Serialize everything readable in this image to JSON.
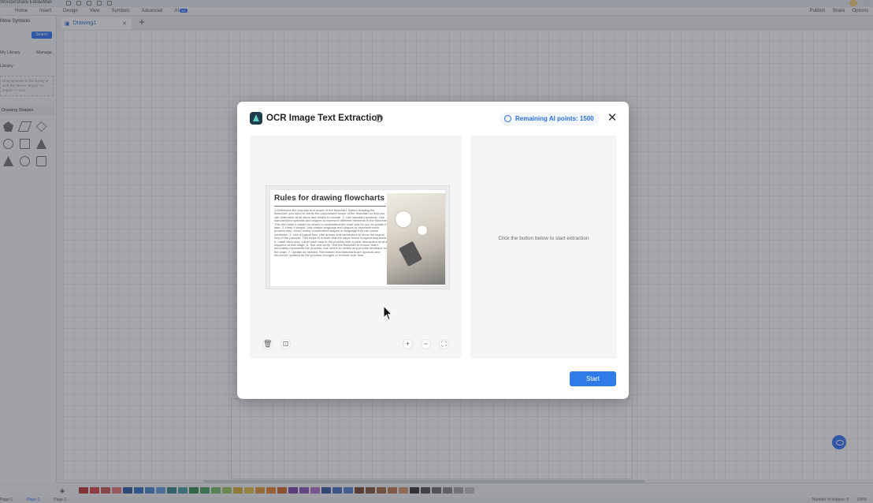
{
  "app": {
    "title": "Wondershare EdrawMax",
    "menu": [
      {
        "label": "Home"
      },
      {
        "label": "Insert"
      },
      {
        "label": "Design"
      },
      {
        "label": "View"
      },
      {
        "label": "Symbols"
      },
      {
        "label": "Advanced"
      },
      {
        "label": "AI",
        "badge": "hot"
      }
    ],
    "actions": {
      "publish": "Publish",
      "share": "Share",
      "options": "Options"
    },
    "doc_tab": "Drawing1"
  },
  "left_panel": {
    "title": "More Symbols",
    "search": "Search",
    "my_library": "My Library",
    "manage": "Manage",
    "library": "Library",
    "library_hint": "Drag symbols to the library or click the above \"Import\" to import \"+\" icon",
    "section": "Drawing Shapes"
  },
  "palette_colors": [
    "#c0393b",
    "#d24b4b",
    "#c85a5a",
    "#e07b7b",
    "#3a5fa6",
    "#3f74c4",
    "#4d8ad6",
    "#6aa3e0",
    "#3b8a8a",
    "#4aa3a3",
    "#3c8f5a",
    "#4fa56b",
    "#7bbf6a",
    "#9ccc65",
    "#d9b13b",
    "#e6c24d",
    "#e39b3a",
    "#e8863a",
    "#d46c2e",
    "#7a4ba6",
    "#8e5cc0",
    "#b072c9",
    "#3b5ea8",
    "#4c6fbf",
    "#5b84d4",
    "#7a4a3a",
    "#8c5a44",
    "#a56a4a",
    "#c27a52",
    "#d49873",
    "#3a3a3a",
    "#555555",
    "#707070",
    "#8a8a8a",
    "#a8a8a8",
    "#c4c4c4"
  ],
  "status": {
    "pages": [
      "Page-1",
      "Page-1",
      "Page-1"
    ],
    "shapes": "Number of shapes: 0",
    "zoom": "100%"
  },
  "dialog": {
    "title": "OCR Image Text Extraction",
    "ai_points_label": "Remaining AI points: 1500",
    "hint": "Click the button below to start extraction",
    "start_button": "Start",
    "preview": {
      "heading": "Rules for drawing flowcharts",
      "body": "1.Determine the purpose and scope of the flowchart. Before drawing the flowchart, you need to clarify the purposeand scope of the flowchart so that you can determine what steps and details to include. 2. Use standard symbols. Use standardized symbols and shapes to represent different elements in the flowchart. This will make it easier for others to understand the chart and for you to update it later. 3. Keep it simple. Use simple language and shapes to represent each process step. Avoid overly complicated shapes or language that can cause confusion. 4. Use a logical flow. Use arrows and connectors to show the logical flow of the process. This helps to ensure that the steps follow a logical sequence. 5. Label each step. Label each step in the process with a clear description of what happens at that stage. 6. Test and verify. Test the flowchart to ensure that it accurately represents the process. Ask others to review and provide feedback on the chart. 7. Update as needed. Remember that flowcharts are dynamic and should be updated as the process changes or evolves over time."
    }
  }
}
